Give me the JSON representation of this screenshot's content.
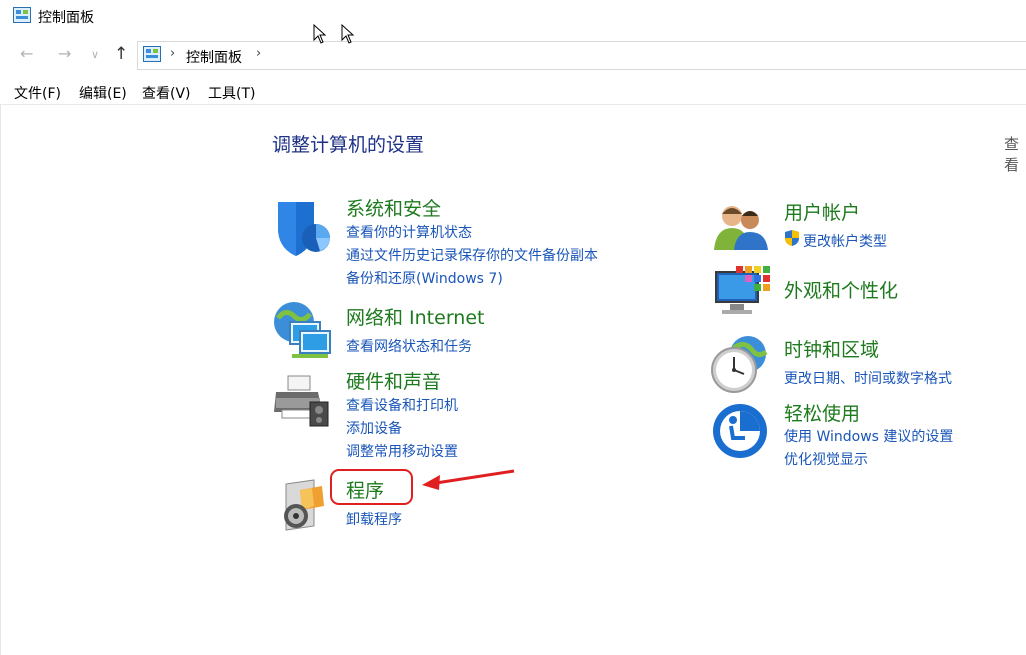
{
  "window": {
    "title": "控制面板"
  },
  "addressbar": {
    "breadcrumb": "控制面板"
  },
  "menubar": [
    {
      "label": "文件(F)"
    },
    {
      "label": "编辑(E)"
    },
    {
      "label": "查看(V)"
    },
    {
      "label": "工具(T)"
    }
  ],
  "main": {
    "heading": "调整计算机的设置",
    "view_by": "查看",
    "left_categories": [
      {
        "title": "系统和安全",
        "icon": "shield-icon",
        "links": [
          "查看你的计算机状态",
          "通过文件历史记录保存你的文件备份副本",
          "备份和还原(Windows 7)"
        ]
      },
      {
        "title": "网络和 Internet",
        "icon": "network-icon",
        "links": [
          "查看网络状态和任务"
        ]
      },
      {
        "title": "硬件和声音",
        "icon": "printer-icon",
        "links": [
          "查看设备和打印机",
          "添加设备",
          "调整常用移动设置"
        ]
      },
      {
        "title": "程序",
        "icon": "programs-icon",
        "links": [
          "卸载程序"
        ]
      }
    ],
    "right_categories": [
      {
        "title": "用户帐户",
        "icon": "users-icon",
        "links": [
          "更改帐户类型"
        ]
      },
      {
        "title": "外观和个性化",
        "icon": "display-icon",
        "links": []
      },
      {
        "title": "时钟和区域",
        "icon": "clock-globe-icon",
        "links": [
          "更改日期、时间或数字格式"
        ]
      },
      {
        "title": "轻松使用",
        "icon": "ease-of-access-icon",
        "links": [
          "使用 Windows 建议的设置",
          "优化视觉显示"
        ]
      }
    ]
  },
  "colors": {
    "heading": "#1e3287",
    "category_title": "#1e7a1e",
    "link": "#1a56b8",
    "highlight": "#e02020"
  }
}
